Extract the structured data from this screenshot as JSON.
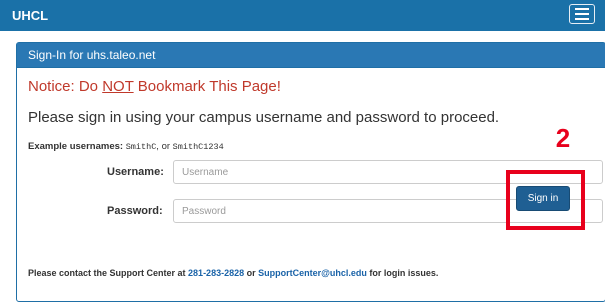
{
  "navbar": {
    "brand": "UHCL",
    "menu_icon": "hamburger-menu-icon"
  },
  "panel": {
    "title": "Sign-In for uhs.taleo.net",
    "notice_prefix": "Notice: Do ",
    "notice_emphasis": "NOT",
    "notice_suffix": " Bookmark This Page!",
    "instructions": "Please sign in using your campus username and password to proceed.",
    "examples_label": "Example usernames:",
    "example_1": "SmithC",
    "examples_sep": ", or ",
    "example_2": "SmithC1234"
  },
  "form": {
    "username_label": "Username:",
    "username_placeholder": "Username",
    "username_value": "",
    "password_label": "Password:",
    "password_placeholder": "Password",
    "password_value": "",
    "signin_label": "Sign in"
  },
  "contact": {
    "prefix": "Please contact the Support Center at ",
    "phone": "281-283-2828",
    "middle": " or ",
    "email": "SupportCenter@uhcl.edu",
    "suffix": " for login issues."
  },
  "annotation": {
    "number": "2",
    "color": "#e8001c"
  },
  "colors": {
    "navbar": "#1a71a8",
    "panel_header": "#2a78b4",
    "notice": "#c0392b",
    "button": "#1f5f93",
    "link": "#1a63a8"
  }
}
